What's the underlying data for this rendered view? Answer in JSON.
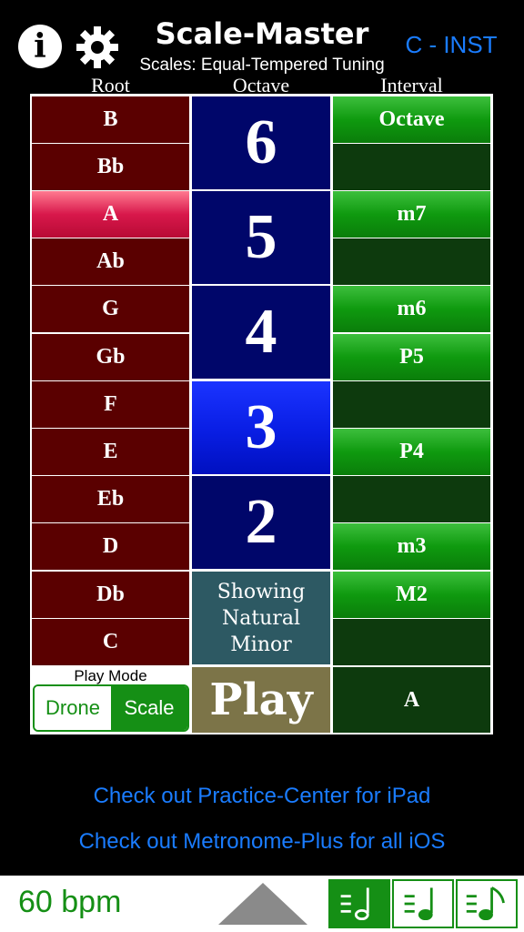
{
  "header": {
    "title": "Scale-Master",
    "instrument": "C - INST",
    "subtitle": "Scales: Equal-Tempered Tuning",
    "info_icon": "info-icon",
    "settings_icon": "gear-icon"
  },
  "columns": {
    "root": "Root",
    "octave": "Octave",
    "interval": "Interval"
  },
  "roots": [
    "B",
    "Bb",
    "A",
    "Ab",
    "G",
    "Gb",
    "F",
    "E",
    "Eb",
    "D",
    "Db",
    "C"
  ],
  "selected_root": "A",
  "octaves": [
    "6",
    "5",
    "4",
    "3",
    "2"
  ],
  "selected_octave": "3",
  "intervals": [
    "Octave",
    "",
    "m7",
    "",
    "m6",
    "P5",
    "",
    "P4",
    "",
    "m3",
    "M2",
    ""
  ],
  "showing": {
    "line1": "Showing",
    "line2": "Natural",
    "line3": "Minor"
  },
  "play_mode": {
    "label": "Play Mode",
    "drone": "Drone",
    "scale": "Scale",
    "selected": "Scale"
  },
  "play_label": "Play",
  "current_root": "A",
  "promos": [
    "Check out Practice-Center for iPad",
    "Check out Metronome-Plus for all iOS"
  ],
  "bottom": {
    "bpm": "60 bpm",
    "selected_subdivision": "quarter-note-icon"
  },
  "colors": {
    "accent_blue": "#1a7cff",
    "green": "#158f15",
    "root_bg": "#5a0000",
    "octave_bg": "#00066a",
    "interval_bg": "#0d3a0d"
  }
}
